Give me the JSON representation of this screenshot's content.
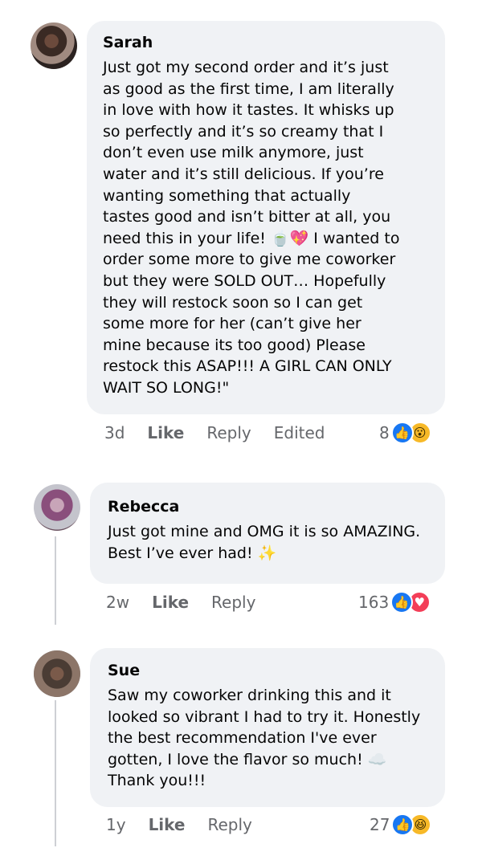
{
  "comments": [
    {
      "author": "Sarah",
      "text": "Just got my second order and it’s just\nas good as the first time, I am literally\nin love with how it tastes. It whisks up\nso perfectly and it’s so creamy that I\ndon’t even use milk anymore, just\nwater and it’s still delicious. If you’re\nwanting something that actually\ntastes good and isn’t bitter at all, you\nneed this in your life! 🍵💖 I wanted to\norder some more to give me coworker\nbut they were SOLD OUT… Hopefully\nthey will restock soon so I can get\nsome more for her (can’t give her\nmine because its too good) Please\nrestock this ASAP!!! A GIRL CAN ONLY\nWAIT SO LONG!\"",
      "time": "3d",
      "like": "Like",
      "reply": "Reply",
      "edited": "Edited",
      "reaction_count": "8",
      "reactions": [
        "like-icon",
        "wow-icon"
      ]
    },
    {
      "author": "Rebecca",
      "text": "Just got mine and OMG it is so AMAZING.\nBest I’ve ever had! ✨",
      "time": "2w",
      "like": "Like",
      "reply": "Reply",
      "reaction_count": "163",
      "reactions": [
        "like-icon",
        "love-icon"
      ]
    },
    {
      "author": "Sue",
      "text": "Saw my coworker drinking this and it\nlooked so vibrant I had to try it. Honestly\nthe best recommendation I've ever\ngotten, I love the flavor so much! ☁️\nThank you!!!",
      "time": "1y",
      "like": "Like",
      "reply": "Reply",
      "reaction_count": "27",
      "reactions": [
        "like-icon",
        "haha-icon"
      ]
    }
  ],
  "colors": {
    "bubble": "#f0f2f5",
    "meta_text": "#65676b",
    "like_blue": "#1877f2",
    "love_red": "#f33e58",
    "emoji_yellow": "#f7b928"
  }
}
